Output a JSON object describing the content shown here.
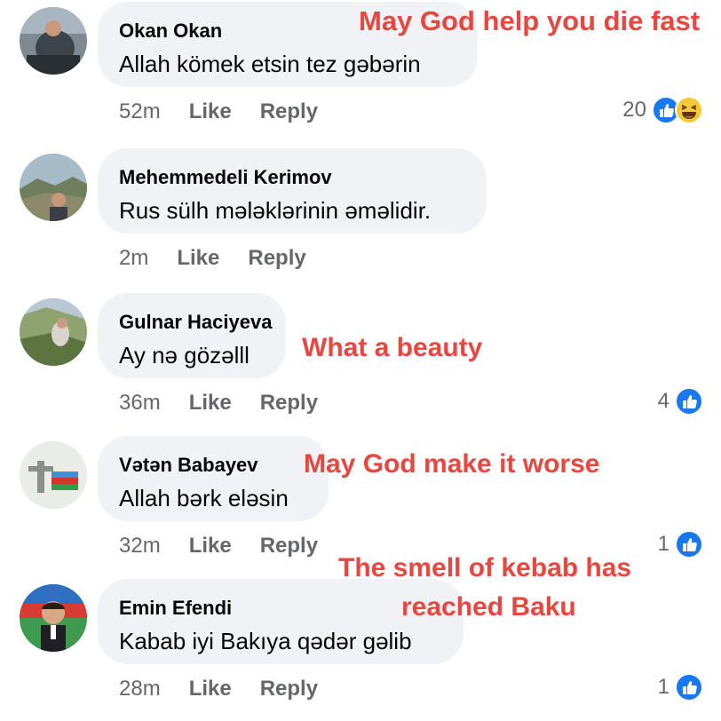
{
  "comments": [
    {
      "author": "Okan Okan",
      "text": "Allah kömek etsin tez gəbərin",
      "time": "52m",
      "like_label": "Like",
      "reply_label": "Reply",
      "reaction_count": "20",
      "reactions": [
        "like-icon",
        "haha-icon"
      ],
      "translation": "May God help you die fast"
    },
    {
      "author": "Mehemmedeli Kerimov",
      "text": "Rus sülh mələklərinin əməlidir.",
      "time": "2m",
      "like_label": "Like",
      "reply_label": "Reply"
    },
    {
      "author": "Gulnar Haciyeva",
      "text": "Ay nə gözəlll",
      "time": "36m",
      "like_label": "Like",
      "reply_label": "Reply",
      "reaction_count": "4",
      "reactions": [
        "like-icon"
      ],
      "translation": "What a beauty"
    },
    {
      "author": "Vətən Babayev",
      "text": "Allah bərk eləsin",
      "time": "32m",
      "like_label": "Like",
      "reply_label": "Reply",
      "reaction_count": "1",
      "reactions": [
        "like-icon"
      ],
      "translation": "May God make it worse"
    },
    {
      "author": "Emin Efendi",
      "text": "Kabab iyi Bakıya qədər gəlib",
      "time": "28m",
      "like_label": "Like",
      "reply_label": "Reply",
      "reaction_count": "1",
      "reactions": [
        "like-icon"
      ],
      "translation_line1": "The smell of kebab has",
      "translation_line2": "reached Baku"
    }
  ],
  "colors": {
    "bubble": "#f0f2f5",
    "meta": "#65676b",
    "like_blue": "#1877f2",
    "annotation_red": "#e8463e"
  }
}
